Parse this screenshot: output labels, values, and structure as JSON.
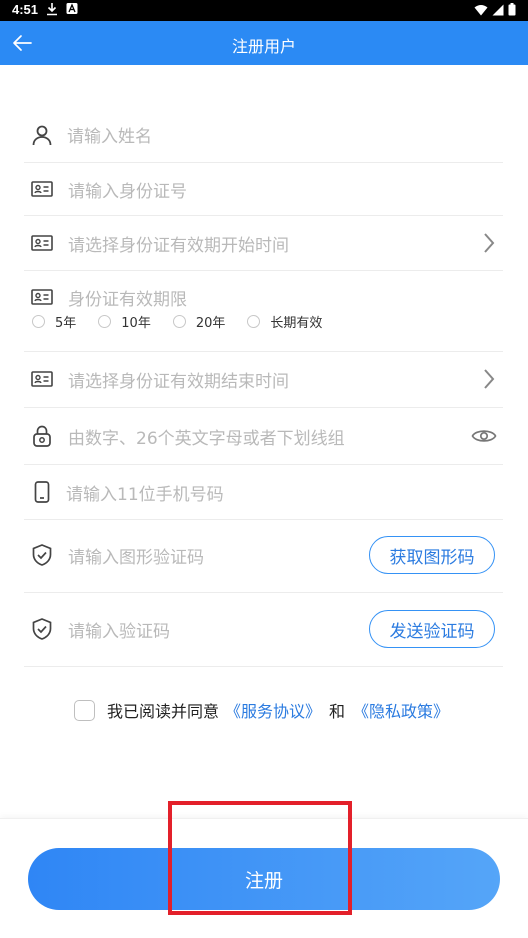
{
  "status": {
    "time": "4:51"
  },
  "header": {
    "title": "注册用户"
  },
  "form": {
    "name_placeholder": "请输入姓名",
    "id_placeholder": "请输入身份证号",
    "start_placeholder": "请选择身份证有效期开始时间",
    "validity_label": "身份证有效期限",
    "validity_options": [
      "5年",
      "10年",
      "20年",
      "长期有效"
    ],
    "end_placeholder": "请选择身份证有效期结束时间",
    "password_placeholder": "由数字、26个英文字母或者下划线组",
    "phone_placeholder": "请输入11位手机号码",
    "captcha_placeholder": "请输入图形验证码",
    "captcha_button": "获取图形码",
    "code_placeholder": "请输入验证码",
    "code_button": "发送验证码"
  },
  "agreement": {
    "prefix": "我已阅读并同意",
    "service": "《服务协议》",
    "and": "和",
    "privacy": "《隐私政策》"
  },
  "submit_label": "注册"
}
